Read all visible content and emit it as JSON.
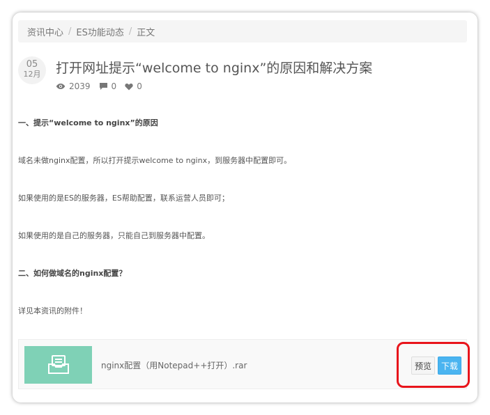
{
  "breadcrumb": {
    "items": [
      "资讯中心",
      "ES功能动态",
      "正文"
    ],
    "separator": "/"
  },
  "date": {
    "day": "05",
    "month": "12月"
  },
  "article": {
    "title": "打开网址提示“welcome to nginx”的原因和解决方案",
    "views": "2039",
    "comments": "0",
    "likes": "0",
    "paragraphs": [
      "一、提示“welcome to nginx”的原因",
      "域名未做nginx配置，所以打开提示welcome to nginx，到服务器中配置即可。",
      "如果使用的是ES的服务器，ES帮助配置，联系运营人员即可；",
      "如果使用的是自己的服务器，只能自己到服务器中配置。",
      "二、如何做域名的nginx配置？",
      "详见本资讯的附件！"
    ]
  },
  "attachment": {
    "filename": "nginx配置（用Notepad++打开）.rar",
    "preview_label": "预览",
    "download_label": "下载"
  },
  "colors": {
    "thumb_bg": "#7fd1b6",
    "download_bg": "#4ab4f0",
    "highlight": "#e8141b"
  },
  "icons": {
    "views": "eye-icon",
    "comments": "comment-icon",
    "likes": "heart-icon",
    "file": "inbox-icon"
  }
}
